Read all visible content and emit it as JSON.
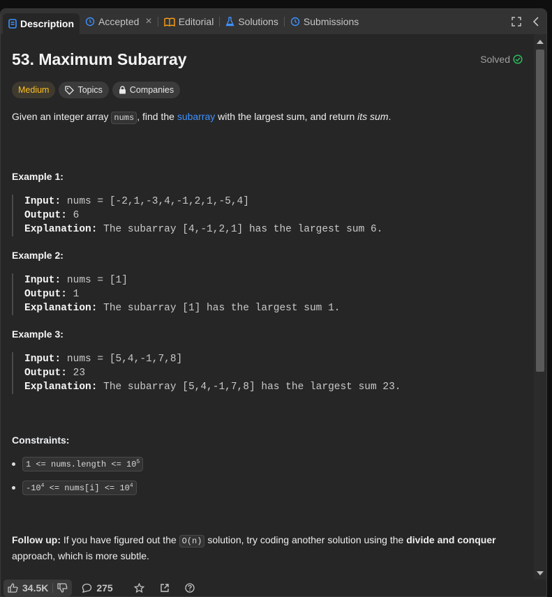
{
  "tabs": {
    "description": "Description",
    "accepted": "Accepted",
    "editorial": "Editorial",
    "solutions": "Solutions",
    "submissions": "Submissions"
  },
  "problem": {
    "title": "53. Maximum Subarray",
    "status": "Solved",
    "difficulty": "Medium",
    "topics_label": "Topics",
    "companies_label": "Companies"
  },
  "description": {
    "part1": "Given an integer array ",
    "code": "nums",
    "part2": ", find the ",
    "link": "subarray",
    "part3": " with the largest sum, and return ",
    "em": "its sum",
    "part4": "."
  },
  "labels": {
    "input": "Input:",
    "output": "Output:",
    "explanation": "Explanation:"
  },
  "examples": [
    {
      "title": "Example 1:",
      "input": "nums = [-2,1,-3,4,-1,2,1,-5,4]",
      "output": "6",
      "explanation": "The subarray [4,-1,2,1] has the largest sum 6."
    },
    {
      "title": "Example 2:",
      "input": "nums = [1]",
      "output": "1",
      "explanation": "The subarray [1] has the largest sum 1."
    },
    {
      "title": "Example 3:",
      "input": "nums = [5,4,-1,7,8]",
      "output": "23",
      "explanation": "The subarray [5,4,-1,7,8] has the largest sum 23."
    }
  ],
  "constraints": {
    "title": "Constraints:",
    "c1_text": "1 <= nums.length <= 10",
    "c1_sup": "5",
    "c2_pre": "-10",
    "c2_sup1": "4",
    "c2_mid": " <= nums[i] <= 10",
    "c2_sup2": "4"
  },
  "follow_up": {
    "label": "Follow up:",
    "part1": " If you have figured out the ",
    "code": "O(n)",
    "part2": " solution, try coding another solution using the ",
    "bold": "divide and conquer",
    "part3": " approach, which is more subtle."
  },
  "bottom": {
    "likes": "34.5K",
    "comments": "275"
  },
  "colors": {
    "medium": "#ffc01e",
    "link": "#3e91ff",
    "solved": "#2cbb5d"
  }
}
